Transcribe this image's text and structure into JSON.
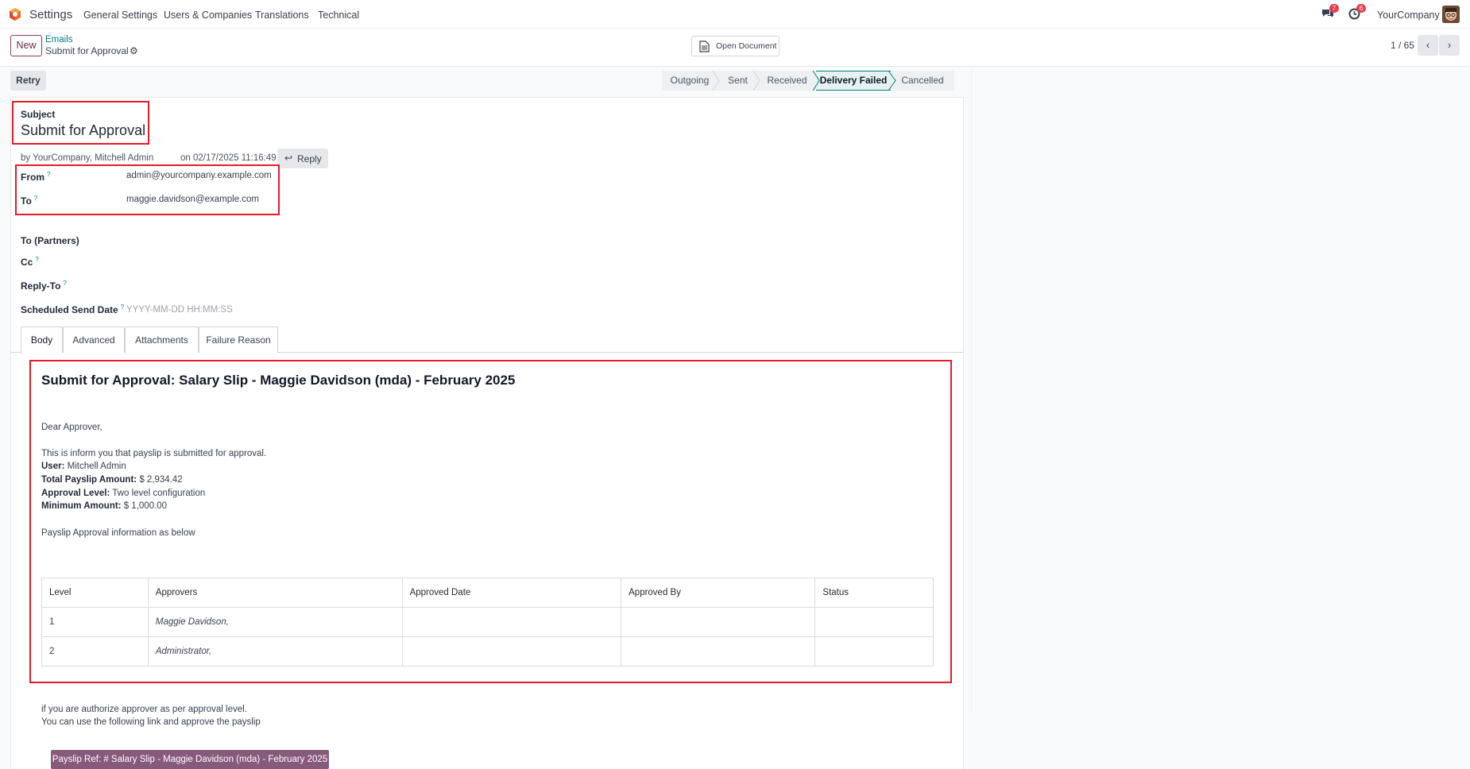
{
  "navbar": {
    "app_name": "Settings",
    "menus": [
      "General Settings",
      "Users & Companies",
      "Translations",
      "Technical"
    ],
    "messages_badge": "7",
    "activity_badge": "6",
    "company": "YourCompany"
  },
  "control_panel": {
    "new_label": "New",
    "breadcrumb_parent": "Emails",
    "breadcrumb_current": "Submit for Approval",
    "open_document_label": "Open Document",
    "pager": "1 / 65"
  },
  "actions": {
    "retry_label": "Retry"
  },
  "statusbar": {
    "stages": [
      "Outgoing",
      "Sent",
      "Received",
      "Delivery Failed",
      "Cancelled"
    ],
    "active": "Delivery Failed"
  },
  "form": {
    "subject_label": "Subject",
    "subject_value": "Submit for Approval",
    "author": "by YourCompany, Mitchell Admin",
    "date": "on 02/17/2025 11:16:49",
    "reply_label": "Reply",
    "fields": {
      "from_label": "From",
      "from_value": "admin@yourcompany.example.com",
      "to_label": "To",
      "to_value": "maggie.davidson@example.com",
      "to_partners_label": "To (Partners)",
      "cc_label": "Cc",
      "reply_to_label": "Reply-To",
      "scheduled_label": "Scheduled Send Date",
      "scheduled_placeholder": "YYYY-MM-DD HH:MM:SS",
      "help_mark": "?"
    },
    "tabs": [
      "Body",
      "Advanced",
      "Attachments",
      "Failure Reason"
    ]
  },
  "mail": {
    "title": "Submit for Approval: Salary Slip - Maggie Davidson (mda) - February 2025",
    "greeting": "Dear Approver,",
    "intro": "This is inform you that payslip is submitted for approval.",
    "user_label": "User:",
    "user_value": "Mitchell Admin",
    "total_label": "Total Payslip Amount:",
    "total_value": "$ 2,934.42",
    "level_label": "Approval Level:",
    "level_value": "Two level configuration",
    "min_label": "Minimum Amount:",
    "min_value": "$ 1,000.00",
    "info": "Payslip Approval information as below",
    "table": {
      "headers": [
        "Level",
        "Approvers",
        "Approved Date",
        "Approved By",
        "Status"
      ],
      "rows": [
        [
          "1",
          "Maggie Davidson,",
          "",
          "",
          ""
        ],
        [
          "2",
          "Administrator,",
          "",
          "",
          ""
        ]
      ]
    },
    "footer_1": "if you are authorize approver as per approval level.",
    "footer_2": "You can use the following link and approve the payslip",
    "payslip_button": "Payslip Ref: # Salary Slip - Maggie Davidson (mda) - February 2025"
  }
}
